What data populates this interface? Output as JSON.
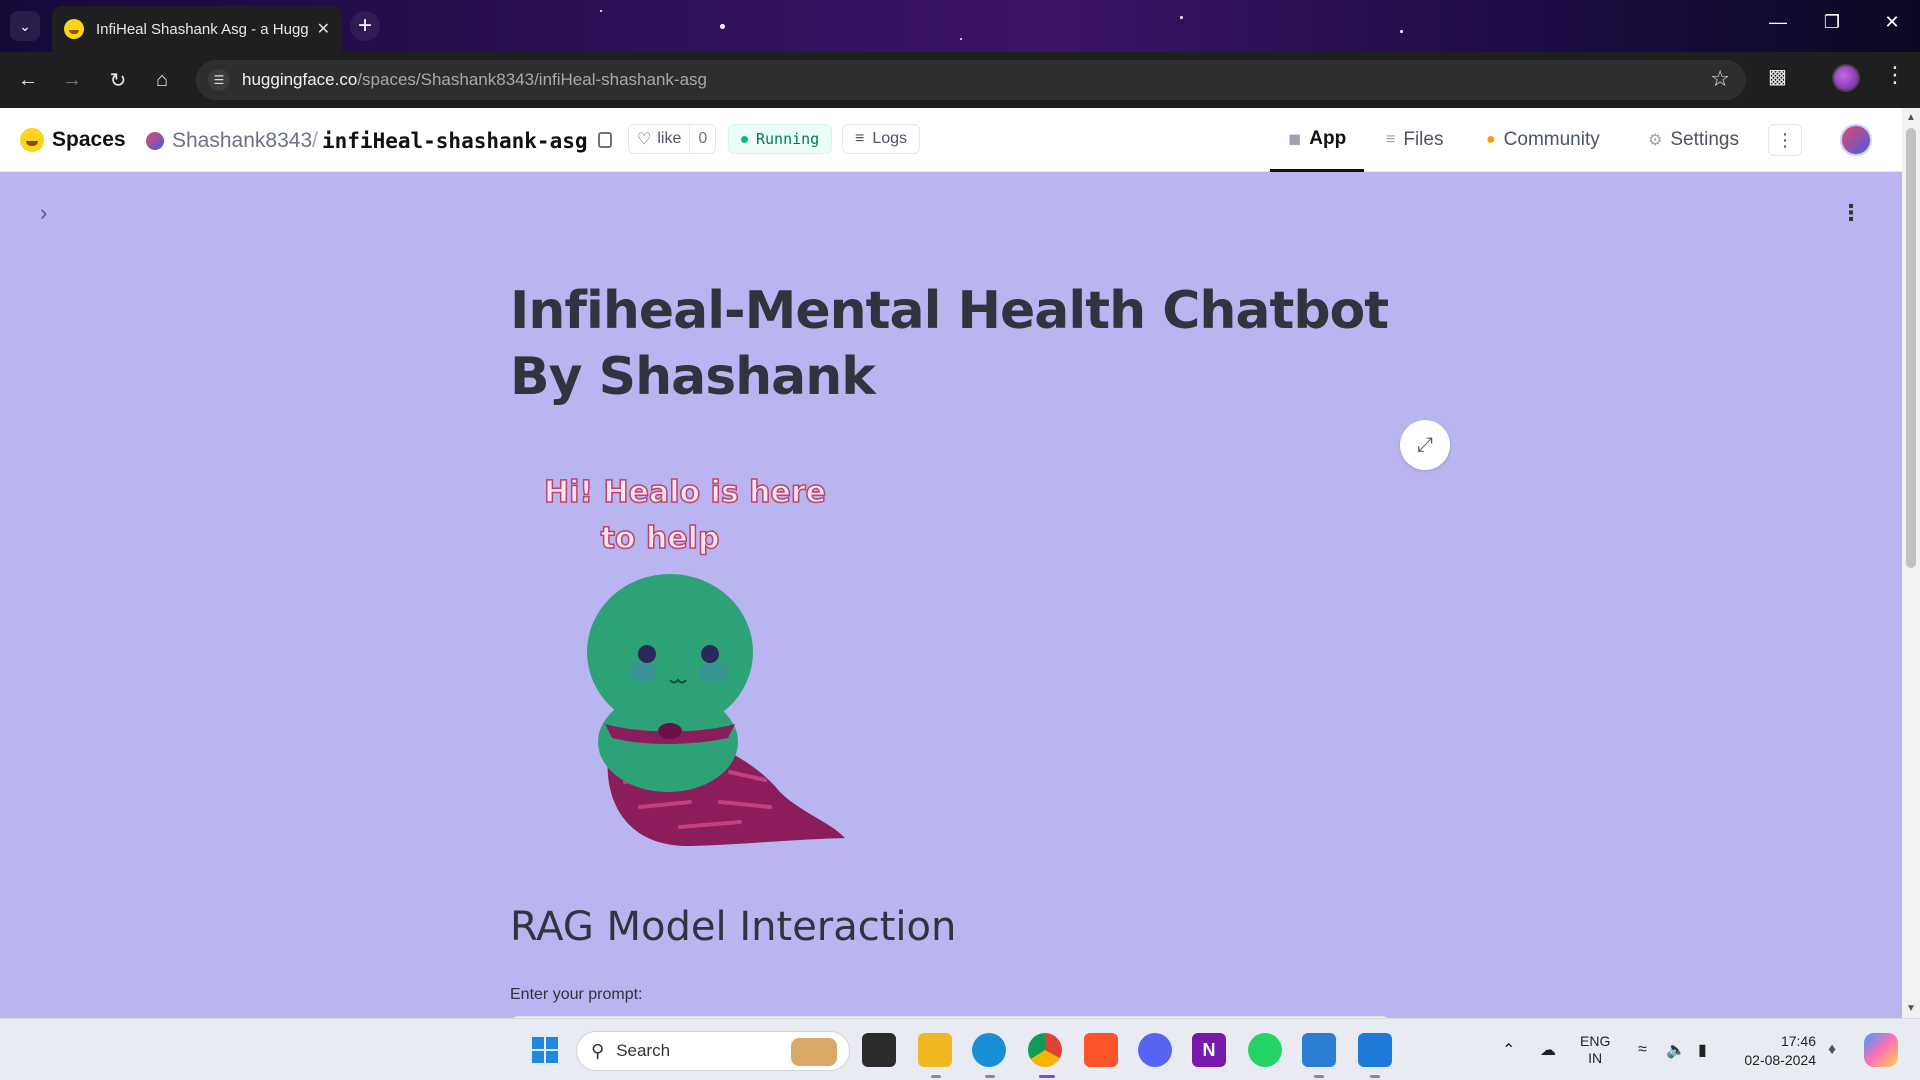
{
  "browser": {
    "tab_title": "InfiHeal Shashank Asg - a Hugg",
    "url_domain": "huggingface.co",
    "url_path": "/spaces/Shashank8343/infiHeal-shashank-asg"
  },
  "hf_header": {
    "spaces_label": "Spaces",
    "owner": "Shashank8343",
    "separator": "/",
    "repo": "infiHeal-shashank-asg",
    "like_label": "like",
    "like_count": "0",
    "status": "Running",
    "logs_label": "Logs",
    "tabs": [
      {
        "label": "App",
        "icon": "cube-icon"
      },
      {
        "label": "Files",
        "icon": "files-icon"
      },
      {
        "label": "Community",
        "icon": "community-icon"
      },
      {
        "label": "Settings",
        "icon": "gear-icon"
      }
    ]
  },
  "app": {
    "title": "Infiheal-Mental Health Chatbot By Shashank",
    "mascot_caption_line1": "Hi! Healo is here",
    "mascot_caption_line2": "to help",
    "section_heading": "RAG Model Interaction",
    "prompt_label": "Enter your prompt:",
    "prompt_value": ""
  },
  "taskbar": {
    "search_placeholder": "Search",
    "lang_line1": "ENG",
    "lang_line2": "IN",
    "time": "17:46",
    "date": "02-08-2024"
  },
  "colors": {
    "app_background": "#b8b5f0",
    "title_color": "#31333f",
    "status_green": "#047857"
  }
}
